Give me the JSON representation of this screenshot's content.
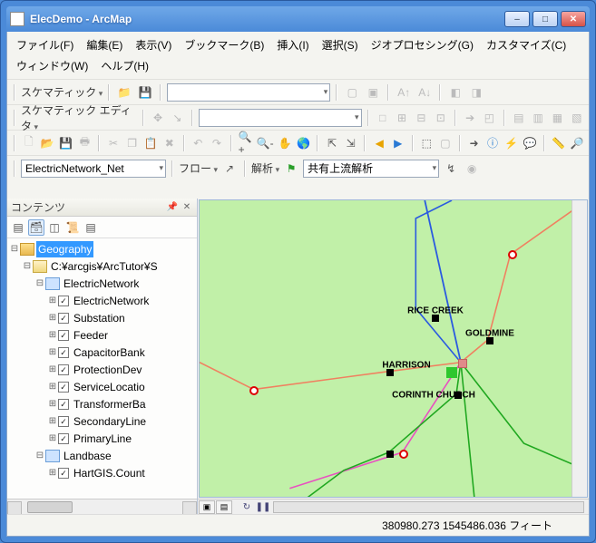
{
  "window": {
    "title": "ElecDemo - ArcMap"
  },
  "menu": {
    "items": [
      "ファイル(F)",
      "編集(E)",
      "表示(V)",
      "ブックマーク(B)",
      "挿入(I)",
      "選択(S)",
      "ジオプロセシング(G)",
      "カスタマイズ(C)",
      "ウィンドウ(W)",
      "ヘルプ(H)"
    ]
  },
  "toolbar1": {
    "label": "スケマティック"
  },
  "toolbar2": {
    "label": "スケマティック エディタ"
  },
  "network": {
    "combo": "ElectricNetwork_Net",
    "flow_label": "フロー",
    "analysis_label": "解析",
    "analysis_combo": "共有上流解析"
  },
  "toc": {
    "title": "コンテンツ",
    "root": "Geography",
    "dataframe": "C:¥arcgis¥ArcTutor¥S",
    "group": "ElectricNetwork",
    "layers": [
      "ElectricNetwork",
      "Substation",
      "Feeder",
      "CapacitorBank",
      "ProtectionDev",
      "ServiceLocatio",
      "TransformerBa",
      "SecondaryLine",
      "PrimaryLine"
    ],
    "group2": "Landbase",
    "layer2": "HartGIS.Count"
  },
  "map": {
    "labels": {
      "rice": "RICE CREEK",
      "gold": "GOLDMINE",
      "harr": "HARRISON",
      "cor": "CORINTH CHURCH"
    }
  },
  "status": {
    "coords": "380980.273 1545486.036 フィート"
  }
}
